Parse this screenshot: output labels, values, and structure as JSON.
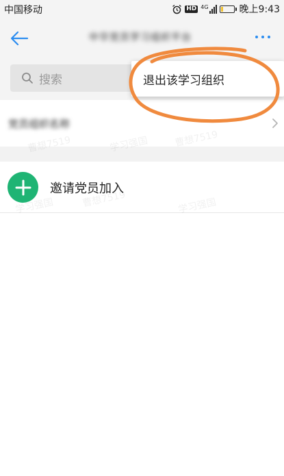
{
  "status_bar": {
    "carrier": "中国移动",
    "hd_badge": "HD",
    "network_type": "4G",
    "time": "晚上9:43",
    "battery_level": 0.2,
    "icons": [
      "alarm-icon",
      "hd-icon",
      "signal-icon",
      "battery-icon"
    ]
  },
  "header": {
    "back_icon": "arrow-left-icon",
    "title": "中华党员学习组织平台",
    "more_icon": "more-dots-icon"
  },
  "search": {
    "placeholder": "搜索",
    "icon": "search-icon"
  },
  "org_row": {
    "name": "党员组织名称",
    "chevron_icon": "chevron-right-icon"
  },
  "invite": {
    "label": "邀请党员加入",
    "icon": "plus-icon"
  },
  "menu": {
    "items": [
      {
        "label": "退出该学习组织"
      }
    ]
  },
  "watermarks": [
    "曹想7519",
    "学习强国",
    "曹想7519",
    "学习强国",
    "曹想7519",
    "学习强国"
  ],
  "colors": {
    "accent_blue": "#2a8cf0",
    "invite_green": "#1fb474",
    "annotation_orange": "#f08a3e",
    "header_bg": "#f4f4f4"
  }
}
